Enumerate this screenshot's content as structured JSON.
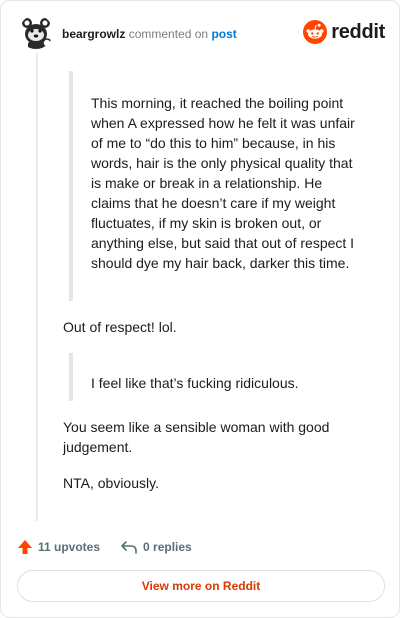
{
  "header": {
    "username": "beargrowlz",
    "action_text": "commented on",
    "post_link": "post",
    "brand": "reddit"
  },
  "comment": {
    "quote1": "This morning, it reached the boiling point when A expressed how he felt it was unfair of me to “do this to him” because, in his words, hair is the only physical quality that is make or break in a relationship. He claims that he doesn’t care if my weight fluctuates, if my skin is broken out, or anything else, but said that out of respect I should dye my hair back, darker this time.",
    "para1": "Out of respect! lol.",
    "quote2": "I feel like that’s fucking ridiculous.",
    "para2": "You seem like a sensible woman with good judgement.",
    "para3": "NTA, obviously."
  },
  "footer": {
    "upvotes": "11 upvotes",
    "replies": "0 replies"
  },
  "button": {
    "label": "View more on Reddit"
  },
  "colors": {
    "brand": "#ff4500",
    "link": "#0079d3",
    "button_text": "#d93a00"
  },
  "icons": [
    "avatar-bear-icon",
    "reddit-logo-icon",
    "upvote-arrow-icon",
    "reply-arrow-icon"
  ]
}
